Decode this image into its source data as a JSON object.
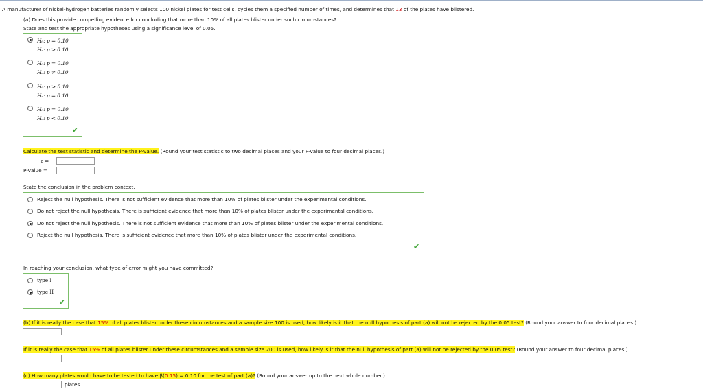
{
  "intro": {
    "before": "A manufacturer of nickel-hydrogen batteries randomly selects 100 nickel plates for test cells, cycles them a specified number of times, and determines that ",
    "count": "13",
    "after": " of the plates have blistered."
  },
  "part_a": {
    "question": "(a) Does this provide compelling evidence for concluding that more than 10% of all plates blister under such circumstances?",
    "instruction": "State and test the appropriate hypotheses using a significance level of 0.05.",
    "hypotheses": [
      {
        "h0": "H₀: p = 0.10",
        "ha": "Hₐ: p > 0.10",
        "selected": true
      },
      {
        "h0": "H₀: p = 0.10",
        "ha": "Hₐ: p ≠ 0.10",
        "selected": false
      },
      {
        "h0": "H₀: p > 0.10",
        "ha": "Hₐ: p = 0.10",
        "selected": false
      },
      {
        "h0": "H₀: p = 0.10",
        "ha": "Hₐ: p < 0.10",
        "selected": false
      }
    ],
    "calc_highlight": "Calculate the test statistic and determine the P-value.",
    "calc_rest": " (Round your test statistic to two decimal places and your P-value to four decimal places.)",
    "z_label": "z =",
    "p_label": "P-value =",
    "conclusion_prompt": "State the conclusion in the problem context.",
    "conclusions": [
      {
        "text": "Reject the null hypothesis. There is not sufficient evidence that more than 10% of plates blister under the experimental conditions.",
        "selected": false
      },
      {
        "text": "Do not reject the null hypothesis. There is sufficient evidence that more than 10% of plates blister under the experimental conditions.",
        "selected": false
      },
      {
        "text": "Do not reject the null hypothesis. There is not sufficient evidence that more than 10% of plates blister under the experimental conditions.",
        "selected": true
      },
      {
        "text": "Reject the null hypothesis. There is sufficient evidence that more than 10% of plates blister under the experimental conditions.",
        "selected": false
      }
    ],
    "error_prompt": "In reaching your conclusion, what type of error might you have committed?",
    "errors": [
      {
        "text": "type I",
        "selected": false
      },
      {
        "text": "type II",
        "selected": true
      }
    ]
  },
  "part_b": {
    "q1_pre": "(b) If it is really the case that ",
    "q1_pct": "15%",
    "q1_post": " of all plates blister under these circumstances and a sample size 100 is used, how likely is it that the null hypothesis of part (a) will not be rejected by the 0.05 test?",
    "q1_note": " (Round your answer to four decimal places.)",
    "q2_pre": "If it is really the case that ",
    "q2_pct": "15%",
    "q2_post": " of all plates blister under these circumstances and a sample size 200 is used, how likely is it that the null hypothesis of part (a) will not be rejected by the 0.05 test?",
    "q2_note": " (Round your answer to four decimal places.)"
  },
  "part_c": {
    "pre": "(c) How many plates would have to be tested to have β(",
    "val": "0.15",
    "post": ") = 0.10 for the test of part (a)?",
    "note": " (Round your answer up to the next whole number.)",
    "unit": "plates"
  },
  "colors": {
    "highlight": "#fff21c",
    "accent_red": "#cc0000",
    "box_border": "#7cbf6a",
    "check": "#3fa535"
  }
}
